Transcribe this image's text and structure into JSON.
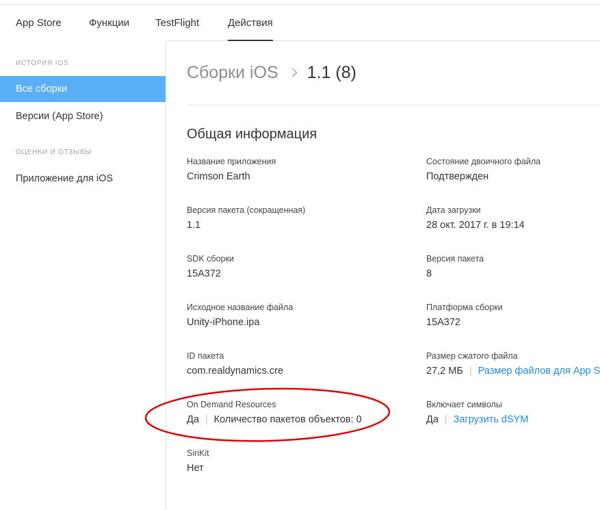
{
  "topnav": {
    "tabs": [
      {
        "label": "App Store"
      },
      {
        "label": "Функции"
      },
      {
        "label": "TestFlight"
      },
      {
        "label": "Действия"
      }
    ]
  },
  "sidebar": {
    "section1_heading": "ИСТОРИЯ iOS",
    "section2_heading": "ОЦЕНКИ И ОТЗЫВЫ",
    "items": [
      {
        "label": "Все сборки"
      },
      {
        "label": "Версии (App Store)"
      },
      {
        "label": "Приложение для iOS"
      }
    ]
  },
  "main": {
    "breadcrumb_parent": "Сборки iOS",
    "breadcrumb_current": "1.1 (8)",
    "section_title": "Общая информация",
    "fields": {
      "app_name": {
        "label": "Название приложения",
        "value": "Crimson Earth"
      },
      "binary_state": {
        "label": "Состояние двоичного файла",
        "value": "Подтвержден"
      },
      "short_version": {
        "label": "Версия пакета (сокращенная)",
        "value": "1.1"
      },
      "upload_date": {
        "label": "Дата загрузки",
        "value": "28 окт. 2017 г. в 19:14"
      },
      "build_sdk": {
        "label": "SDK сборки",
        "value": "15A372"
      },
      "bundle_version": {
        "label": "Версия пакета",
        "value": "8"
      },
      "source_filename": {
        "label": "Исходное название файла",
        "value": "Unity-iPhone.ipa"
      },
      "build_platform": {
        "label": "Платформа сборки",
        "value": "15A372"
      },
      "bundle_id": {
        "label": "ID пакета",
        "value": "com.realdynamics.cre"
      },
      "compressed_size": {
        "label": "Размер сжатого файла",
        "value": "27,2 МБ",
        "link": "Размер файлов для App Store"
      },
      "odr": {
        "label": "On Demand Resources",
        "value": "Да",
        "extra": "Количество пакетов объектов: 0"
      },
      "symbols": {
        "label": "Включает символы",
        "value": "Да",
        "link": "Загрузить dSYM"
      },
      "sirikit": {
        "label": "SiriKit",
        "value": "Нет"
      }
    }
  },
  "colors": {
    "accent": "#5ab0f5",
    "link": "#1d8ce0",
    "annotation": "#e00000"
  }
}
